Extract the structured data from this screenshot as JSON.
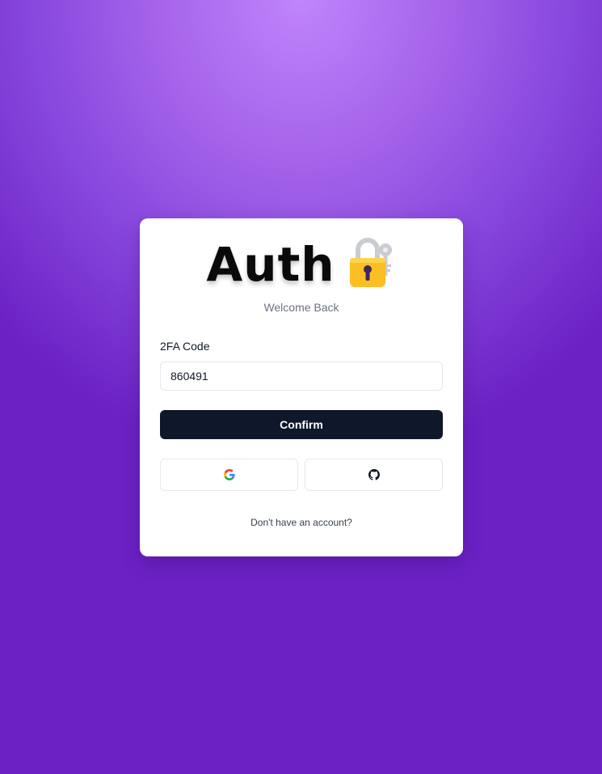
{
  "brand": {
    "title": "Auth",
    "icon": "lock-with-key-icon"
  },
  "subtitle": "Welcome Back",
  "form": {
    "code_label": "2FA Code",
    "code_value": "860491",
    "confirm_label": "Confirm"
  },
  "social": {
    "google_icon": "google-icon",
    "github_icon": "github-icon"
  },
  "footer": {
    "signup_text": "Don't have an account?"
  },
  "colors": {
    "background_gradient": [
      "#c084fc",
      "#6b21c4"
    ],
    "button_primary": "#0f172a",
    "lock_body": "#fbbf24",
    "key": "#d1d5db"
  }
}
